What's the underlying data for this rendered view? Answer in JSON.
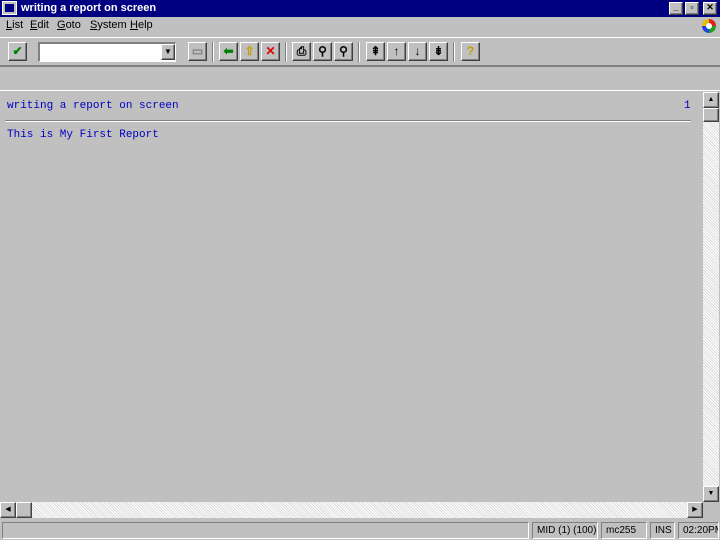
{
  "window": {
    "title": "writing a report on screen",
    "min_label": "_",
    "max_label": "▫",
    "close_label": "✕"
  },
  "menu": [
    {
      "accel": "L",
      "rest": "ist"
    },
    {
      "accel": "E",
      "rest": "dit"
    },
    {
      "accel": "G",
      "rest": "oto"
    },
    {
      "accel": "S",
      "rest": "ystem"
    },
    {
      "accel": "H",
      "rest": "elp"
    }
  ],
  "toolbar": {
    "enter_glyph": "✔",
    "enter_color": "#008000",
    "command_field_value": "",
    "dropdown_glyph": "▼",
    "save_glyph": "▭",
    "back_glyph": "⬅",
    "back_color": "#008000",
    "exit_glyph": "⇧",
    "exit_color": "#c0a000",
    "cancel_glyph": "✕",
    "cancel_color": "#e00000",
    "print_glyph": "⎙",
    "find_glyph": "⚲",
    "find_next_glyph": "⚲",
    "first_page_glyph": "⇞",
    "prev_page_glyph": "↑",
    "next_page_glyph": "↓",
    "last_page_glyph": "⇟",
    "help_glyph": "?",
    "help_color": "#c0a000"
  },
  "list": {
    "header": "writing a report on screen",
    "page_number": "1",
    "line_1": "This is My First Report",
    "text_color": "#0000c0"
  },
  "scroll": {
    "up": "▲",
    "down": "▼",
    "left": "◀",
    "right": "▶"
  },
  "status": {
    "message": "",
    "system": "MID (1) (100)",
    "server": "mc255",
    "mode": "INS",
    "time": "02:20PM"
  }
}
